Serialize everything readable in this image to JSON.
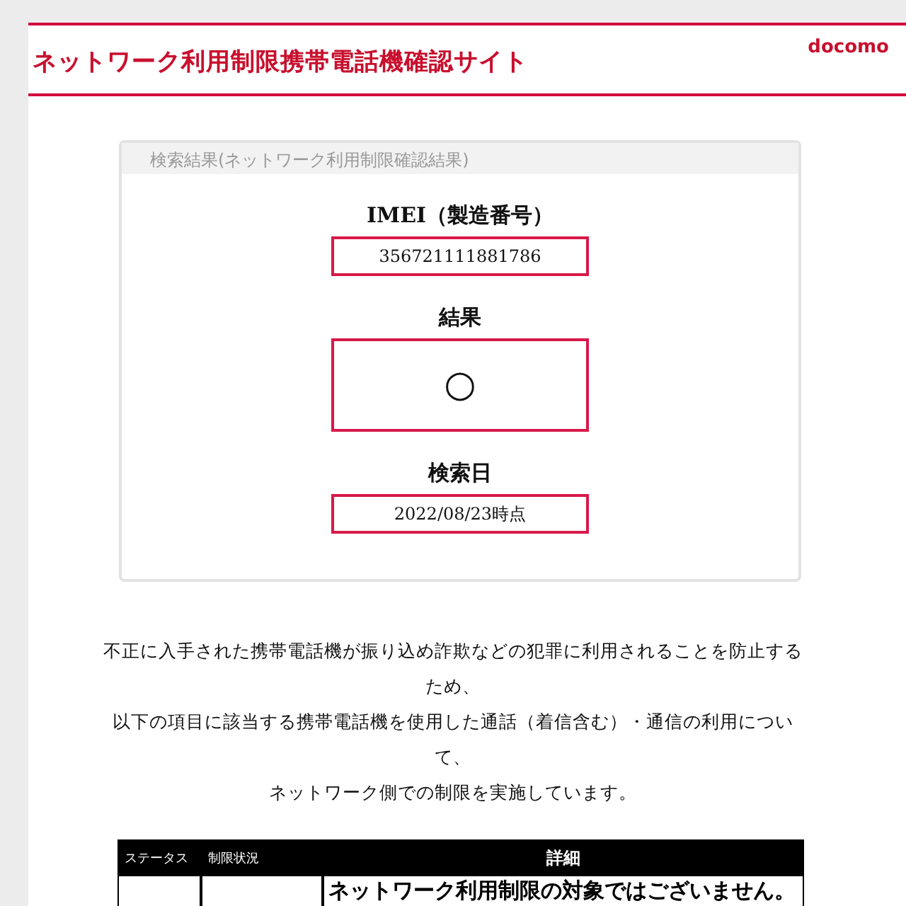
{
  "header": {
    "title": "ネットワーク利用制限携帯電話機確認サイト",
    "logo": "docomo"
  },
  "result_card": {
    "heading": "検索結果(ネットワーク利用制限確認結果)",
    "fields": [
      {
        "label": "IMEI（製造番号）",
        "value": "356721111881786",
        "kind": "text"
      },
      {
        "label": "結果",
        "value": "○",
        "kind": "symbol"
      },
      {
        "label": "検索日",
        "value": "2022/08/23時点",
        "kind": "text"
      }
    ]
  },
  "notice_lines": [
    "不正に入手された携帯電話機が振り込め詐欺などの犯罪に利用されることを防止する",
    "ため、",
    "以下の項目に該当する携帯電話機を使用した通話（着信含む）・通信の利用につい",
    "て、",
    "ネットワーク側での制限を実施しています。"
  ],
  "table": {
    "columns": [
      "ステータス",
      "制限状況",
      "詳細"
    ],
    "rows": [
      [
        "",
        "",
        "ネットワーク利用制限の対象ではございません。"
      ]
    ]
  }
}
